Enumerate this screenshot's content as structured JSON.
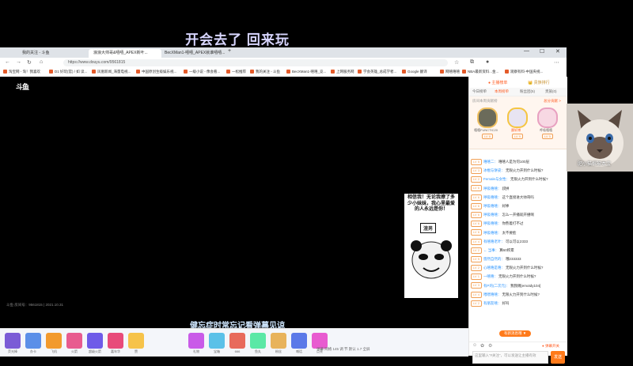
{
  "overlay": {
    "banner_top": "开会去了 回来玩",
    "caption": "健忘症时常忘记看弹幕见谅",
    "cam_text": "肥小猫棉被本宝"
  },
  "browser": {
    "tabs": [
      "我的关注 - 斗鱼",
      "浪浪大帅哥&嘻嘻_APEX新叶...",
      "BecXMan1-嘻嘻_APEX就谁嘻嘻..."
    ],
    "url": "https://www.douyu.com/9561815",
    "bookmarks": [
      "淘宝网 - 淘！我喜欢",
      "D1 好玩(官) / 如 读...",
      "凤凰新闻_海量电视...",
      "中国原创生级娱乐视...",
      "一级小说 - 像会看...",
      "一松推荐",
      "我的关注 - 斗鱼",
      "BecXMan1-嘻嘻_竞...",
      "上网服务网",
      "学会英雄_总成学者...",
      "Google 翻译",
      "网嘻嘻嘻",
      "NBA最新资料...金...",
      "观察有料-中国央视..."
    ]
  },
  "player": {
    "watermark": "斗鱼",
    "stream_info": "斗鱼 房间号：9561815 | 2021.10.31",
    "meme_text": "相信我！无论我撩了多少小妹妹，我心里最爱的人永远是你！",
    "meme_stamp": "渣男",
    "controls": "     弹幕   网络   145    调 节    默认 1.7    全屏     "
  },
  "gifts": [
    {
      "label": "荧光棒",
      "color": "#7a5bd6"
    },
    {
      "label": "办卡",
      "color": "#5b8fe8"
    },
    {
      "label": "飞机",
      "color": "#f29a2e"
    },
    {
      "label": "火箭",
      "color": "#e85b8f"
    },
    {
      "label": "超级火箭",
      "color": "#6e5be8"
    },
    {
      "label": "嘉年华",
      "color": "#e84b7a"
    },
    {
      "label": "赞",
      "color": "#f6c34a"
    },
    {
      "label": "礼物",
      "color": "#c95be8"
    },
    {
      "label": "宝箱",
      "color": "#5bc1e8"
    },
    {
      "label": "666",
      "color": "#e86a5b"
    },
    {
      "label": "鱼丸",
      "color": "#5be8a6"
    },
    {
      "label": "粉丝",
      "color": "#e8b35b"
    },
    {
      "label": "喊话",
      "color": "#5b79e8"
    },
    {
      "label": "点亮",
      "color": "#e85bd0"
    }
  ],
  "sidebar": {
    "top_left": "● 主播榜单",
    "top_right": "👑 贵族排行",
    "tabs": [
      "今日榜单",
      "本周榜单",
      "粉丝团(5)",
      "贵族(0)"
    ],
    "rank_header": "房间本周贡献榜",
    "rank_header_right": "总分贡献 >",
    "rank": [
      {
        "name": "嘻嘻FUNCTIC2000",
        "badge": "LV 8"
      },
      {
        "name": "晨轩博",
        "badge": "LV 9"
      },
      {
        "name": "呼吸嘻嘻",
        "badge": "LV 5"
      }
    ],
    "chat": [
      {
        "lv": "LV 5",
        "nick": "嘻嘻二：",
        "text": "嘻嘻人是为何100层"
      },
      {
        "lv": "LV 3",
        "nick": "冰棍与饼皮：",
        "text": "无限火力开到什么时候?"
      },
      {
        "lv": "LV 2",
        "nick": "Female与女性：",
        "text": "无限火力开到什么时候?"
      },
      {
        "lv": "LV 6",
        "nick": "呼吸嘻嘻：",
        "text": "叔拼"
      },
      {
        "lv": "LV 6",
        "nick": "呼吸嘻嘻：",
        "text": "这个直接进大帅哥吗"
      },
      {
        "lv": "LV 6",
        "nick": "呼吸嘻嘻：",
        "text": "好棒"
      },
      {
        "lv": "LV 6",
        "nick": "呼吸嘻嘻：",
        "text": "怎么一开播就开撞啊"
      },
      {
        "lv": "LV 6",
        "nick": "呼吸嘻嘻：",
        "text": "你熬着打不过"
      },
      {
        "lv": "LV 6",
        "nick": "呼吸嘻嘻：",
        "text": "太不要脸"
      },
      {
        "lv": "LV 4",
        "nick": "有嘻嘻老叶：",
        "text": "可以可以2333"
      },
      {
        "lv": "LV 2",
        "nick": "← 当事：",
        "text": "算60积累"
      },
      {
        "lv": "LV 5",
        "nick": "悠然自然的：",
        "text": "哦233333"
      },
      {
        "lv": "LV 2",
        "nick": "心嘻嘻是嘻：",
        "text": "无限火力开到什么时候?"
      },
      {
        "lv": "LV 1",
        "nick": "一嘻嘻：",
        "text": "无限火力开到什么时候?"
      },
      {
        "lv": "LV 3",
        "nick": "有P的(二次元)：",
        "text": "我我赐[emotdy104]"
      },
      {
        "lv": "LV 4",
        "nick": "喂喂嘻嘻：",
        "text": "无限火力开到什么时候?"
      },
      {
        "lv": "LV 2",
        "nick": "有朋友嘻：",
        "text": "好吗"
      }
    ],
    "new_msg": "有新消息哦 ▼",
    "chat_placeholder": "这里输入“#关注”，可以发送让主播有效",
    "send": "发送",
    "tools_right": "● 弹幕开关"
  }
}
